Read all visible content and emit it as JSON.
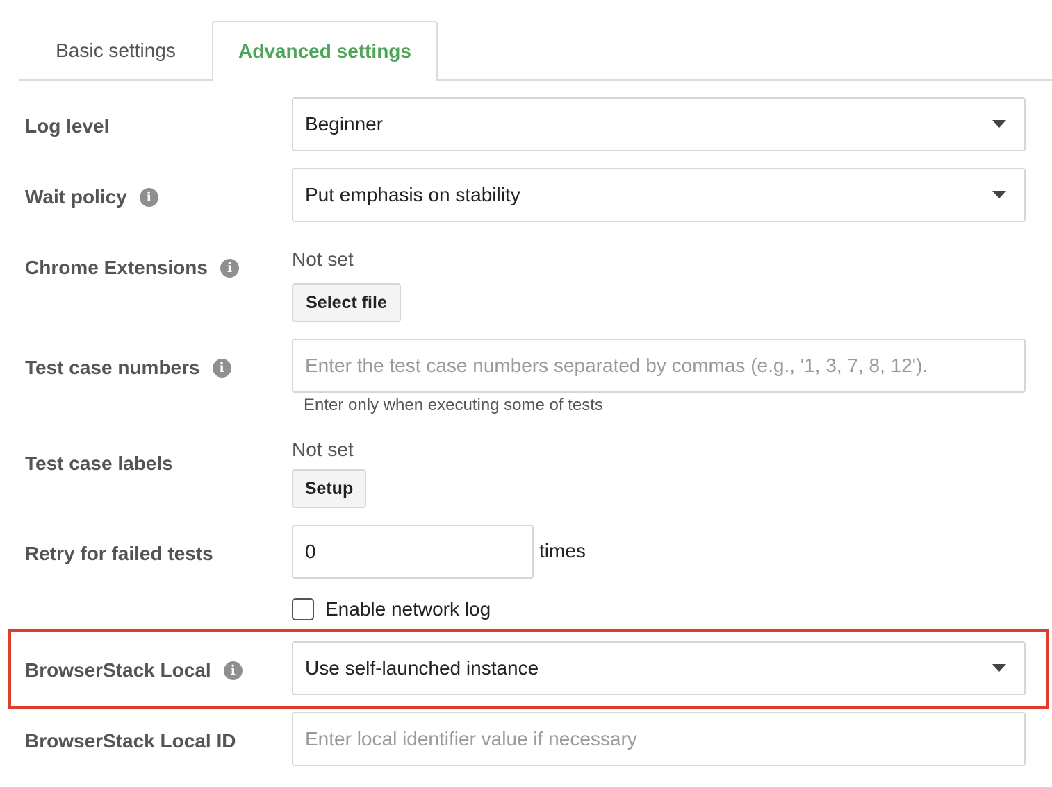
{
  "tabs": {
    "basic": "Basic settings",
    "advanced": "Advanced settings",
    "active": "advanced"
  },
  "log_level": {
    "label": "Log level",
    "value": "Beginner"
  },
  "wait_policy": {
    "label": "Wait policy",
    "value": "Put emphasis on stability"
  },
  "chrome_extensions": {
    "label": "Chrome Extensions",
    "status": "Not set",
    "button": "Select file"
  },
  "test_case_numbers": {
    "label": "Test case numbers",
    "placeholder": "Enter the test case numbers separated by commas (e.g., '1, 3, 7, 8, 12').",
    "hint": "Enter only when executing some of tests"
  },
  "test_case_labels": {
    "label": "Test case labels",
    "status": "Not set",
    "button": "Setup"
  },
  "retry": {
    "label": "Retry for failed tests",
    "value": "0",
    "suffix": "times"
  },
  "network_log": {
    "label": "Enable network log",
    "checked": false
  },
  "browserstack_local": {
    "label": "BrowserStack Local",
    "value": "Use self-launched instance"
  },
  "browserstack_local_id": {
    "label": "BrowserStack Local ID",
    "placeholder": "Enter local identifier value if necessary"
  },
  "icons": {
    "info": "i",
    "dropdown": "caret-down-icon"
  },
  "colors": {
    "active_tab": "#4ea55a",
    "highlight_border": "#e03e2a",
    "label_text": "#555555",
    "info_icon": "#8f8f8f"
  }
}
